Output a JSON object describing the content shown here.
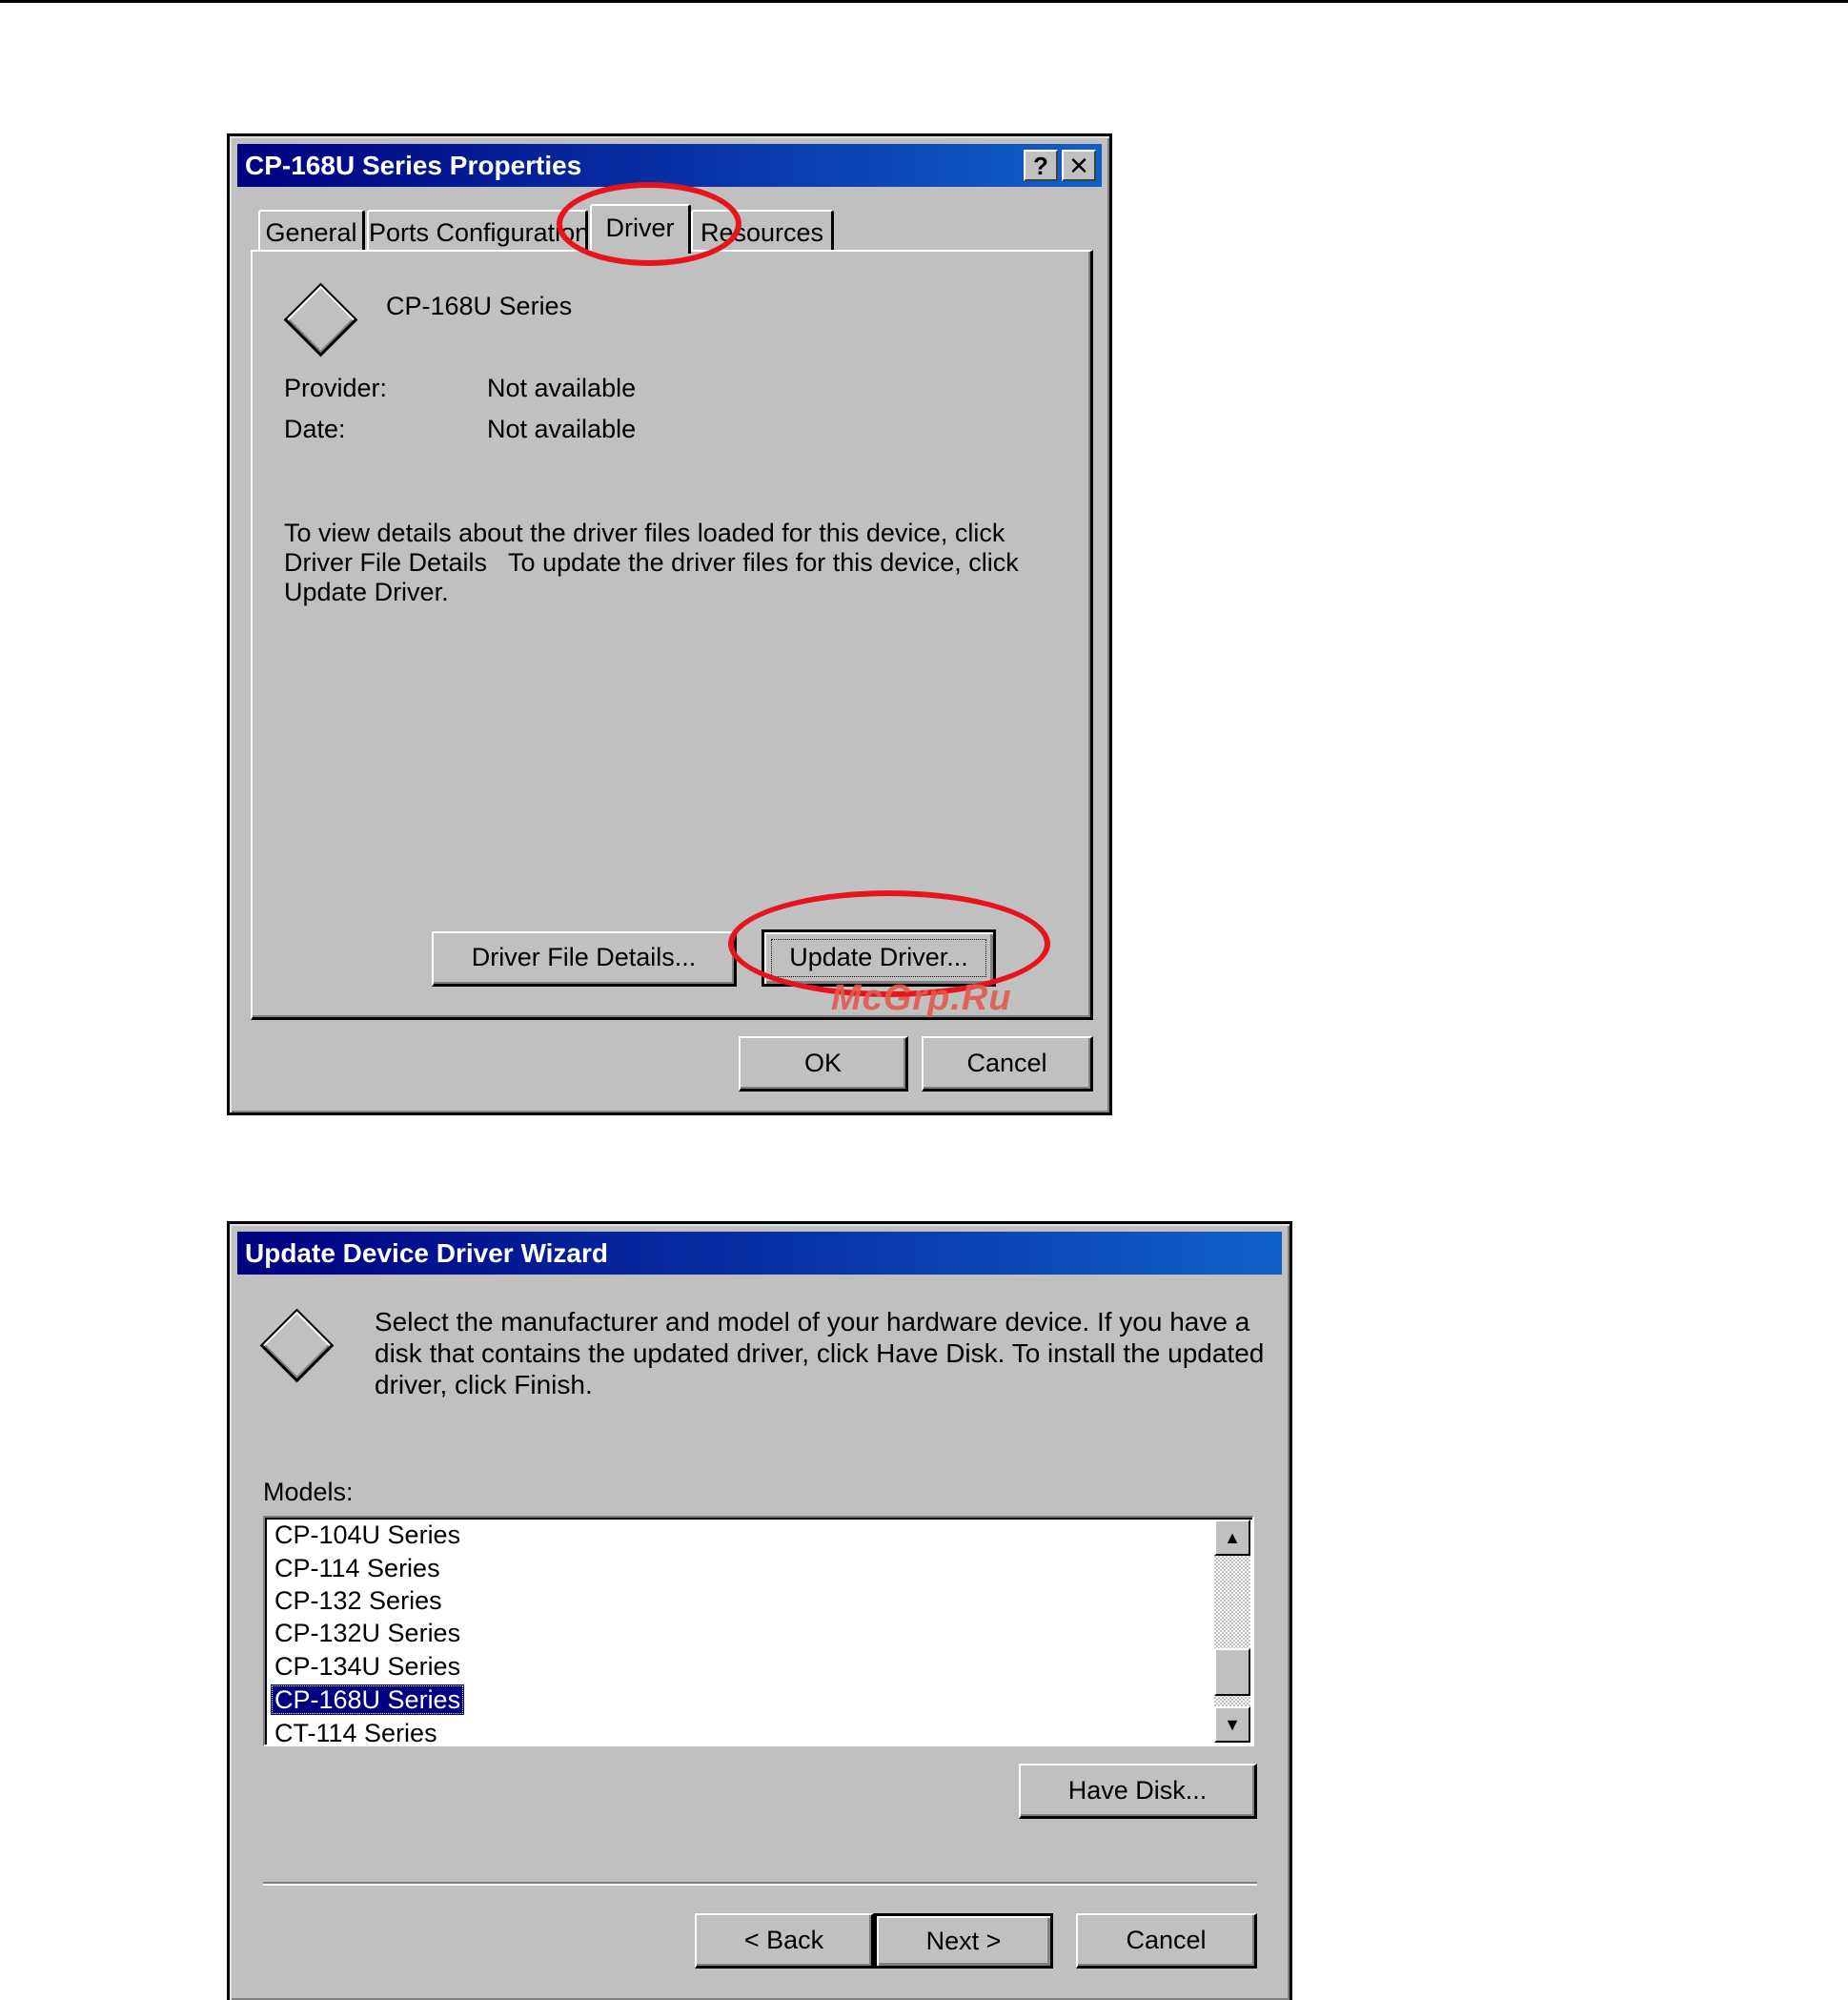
{
  "dialog1": {
    "title": "CP-168U Series Properties",
    "help_glyph": "?",
    "close_glyph": "✕",
    "tabs": [
      "General",
      "Ports Configuration",
      "Driver",
      "Resources"
    ],
    "active_tab": "Driver",
    "device_name": "CP-168U Series",
    "provider_label": "Provider:",
    "provider_value": "Not available",
    "date_label": "Date:",
    "date_value": "Not available",
    "description_lines": [
      "To view details about the driver files loaded for this device, click",
      "Driver File Details   To update the driver files for this device, click",
      "Update Driver."
    ],
    "driver_file_details_button": "Driver File Details...",
    "update_driver_button": "Update Driver...",
    "ok_button": "OK",
    "cancel_button": "Cancel",
    "watermark": "McGrp.Ru"
  },
  "dialog2": {
    "title": "Update Device Driver Wizard",
    "description_lines": [
      "Select the manufacturer and model of your hardware device. If you have a",
      "disk that contains the updated driver, click Have Disk. To install the updated",
      "driver, click Finish."
    ],
    "models_label": "Models:",
    "models": [
      "CP-104U Series",
      "CP-114 Series",
      "CP-132 Series",
      "CP-132U Series",
      "CP-134U Series",
      "CP-168U Series",
      "CT-114 Series"
    ],
    "selected_model": "CP-168U Series",
    "scroll_up_glyph": "▲",
    "scroll_down_glyph": "▼",
    "have_disk_button": "Have Disk...",
    "back_button": "< Back",
    "next_button": "Next >",
    "cancel_button": "Cancel"
  },
  "accent_colors": {
    "titlebar_start": "#000080",
    "titlebar_end": "#1060c8",
    "highlight_ellipse": "#e8141c",
    "selection": "#000080"
  }
}
